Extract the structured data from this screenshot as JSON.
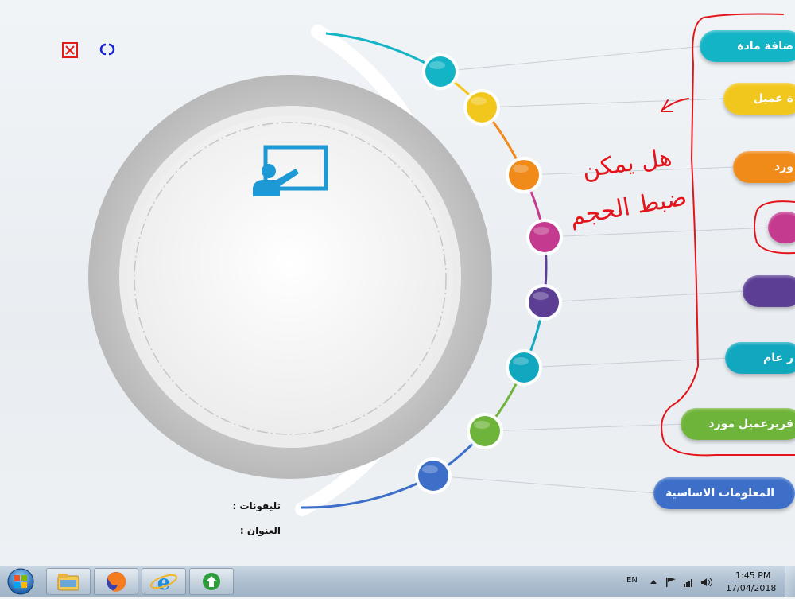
{
  "window": {
    "close_label": "☒",
    "refresh_label": "⟳"
  },
  "menu": {
    "items": [
      {
        "label": "ضافة مادة",
        "color": "#13b4c6"
      },
      {
        "label": "ة عميل",
        "color": "#f2c71d"
      },
      {
        "label": "ورد",
        "color": "#f08a19"
      },
      {
        "label": "",
        "color": "#c33a8e"
      },
      {
        "label": "",
        "color": "#5c3f95"
      },
      {
        "label": "ر عام",
        "color": "#11a7bf"
      },
      {
        "label": "قريرعميل مورد",
        "color": "#6fb43a"
      },
      {
        "label": "المعلومات الاساسية",
        "color": "#3d6fc8"
      }
    ]
  },
  "info": {
    "phones_label": "تليفونات :",
    "address_label": "العنوان :"
  },
  "annotation": {
    "line1": "هل يمكن",
    "line2": "ضبط الحجم",
    "color": "#e4141b"
  },
  "taskbar": {
    "language": "EN",
    "time": "1:45 PM",
    "date": "17/04/2018",
    "apps": [
      "start-orb",
      "file-explorer",
      "firefox",
      "internet-explorer",
      "app-launcher"
    ]
  }
}
